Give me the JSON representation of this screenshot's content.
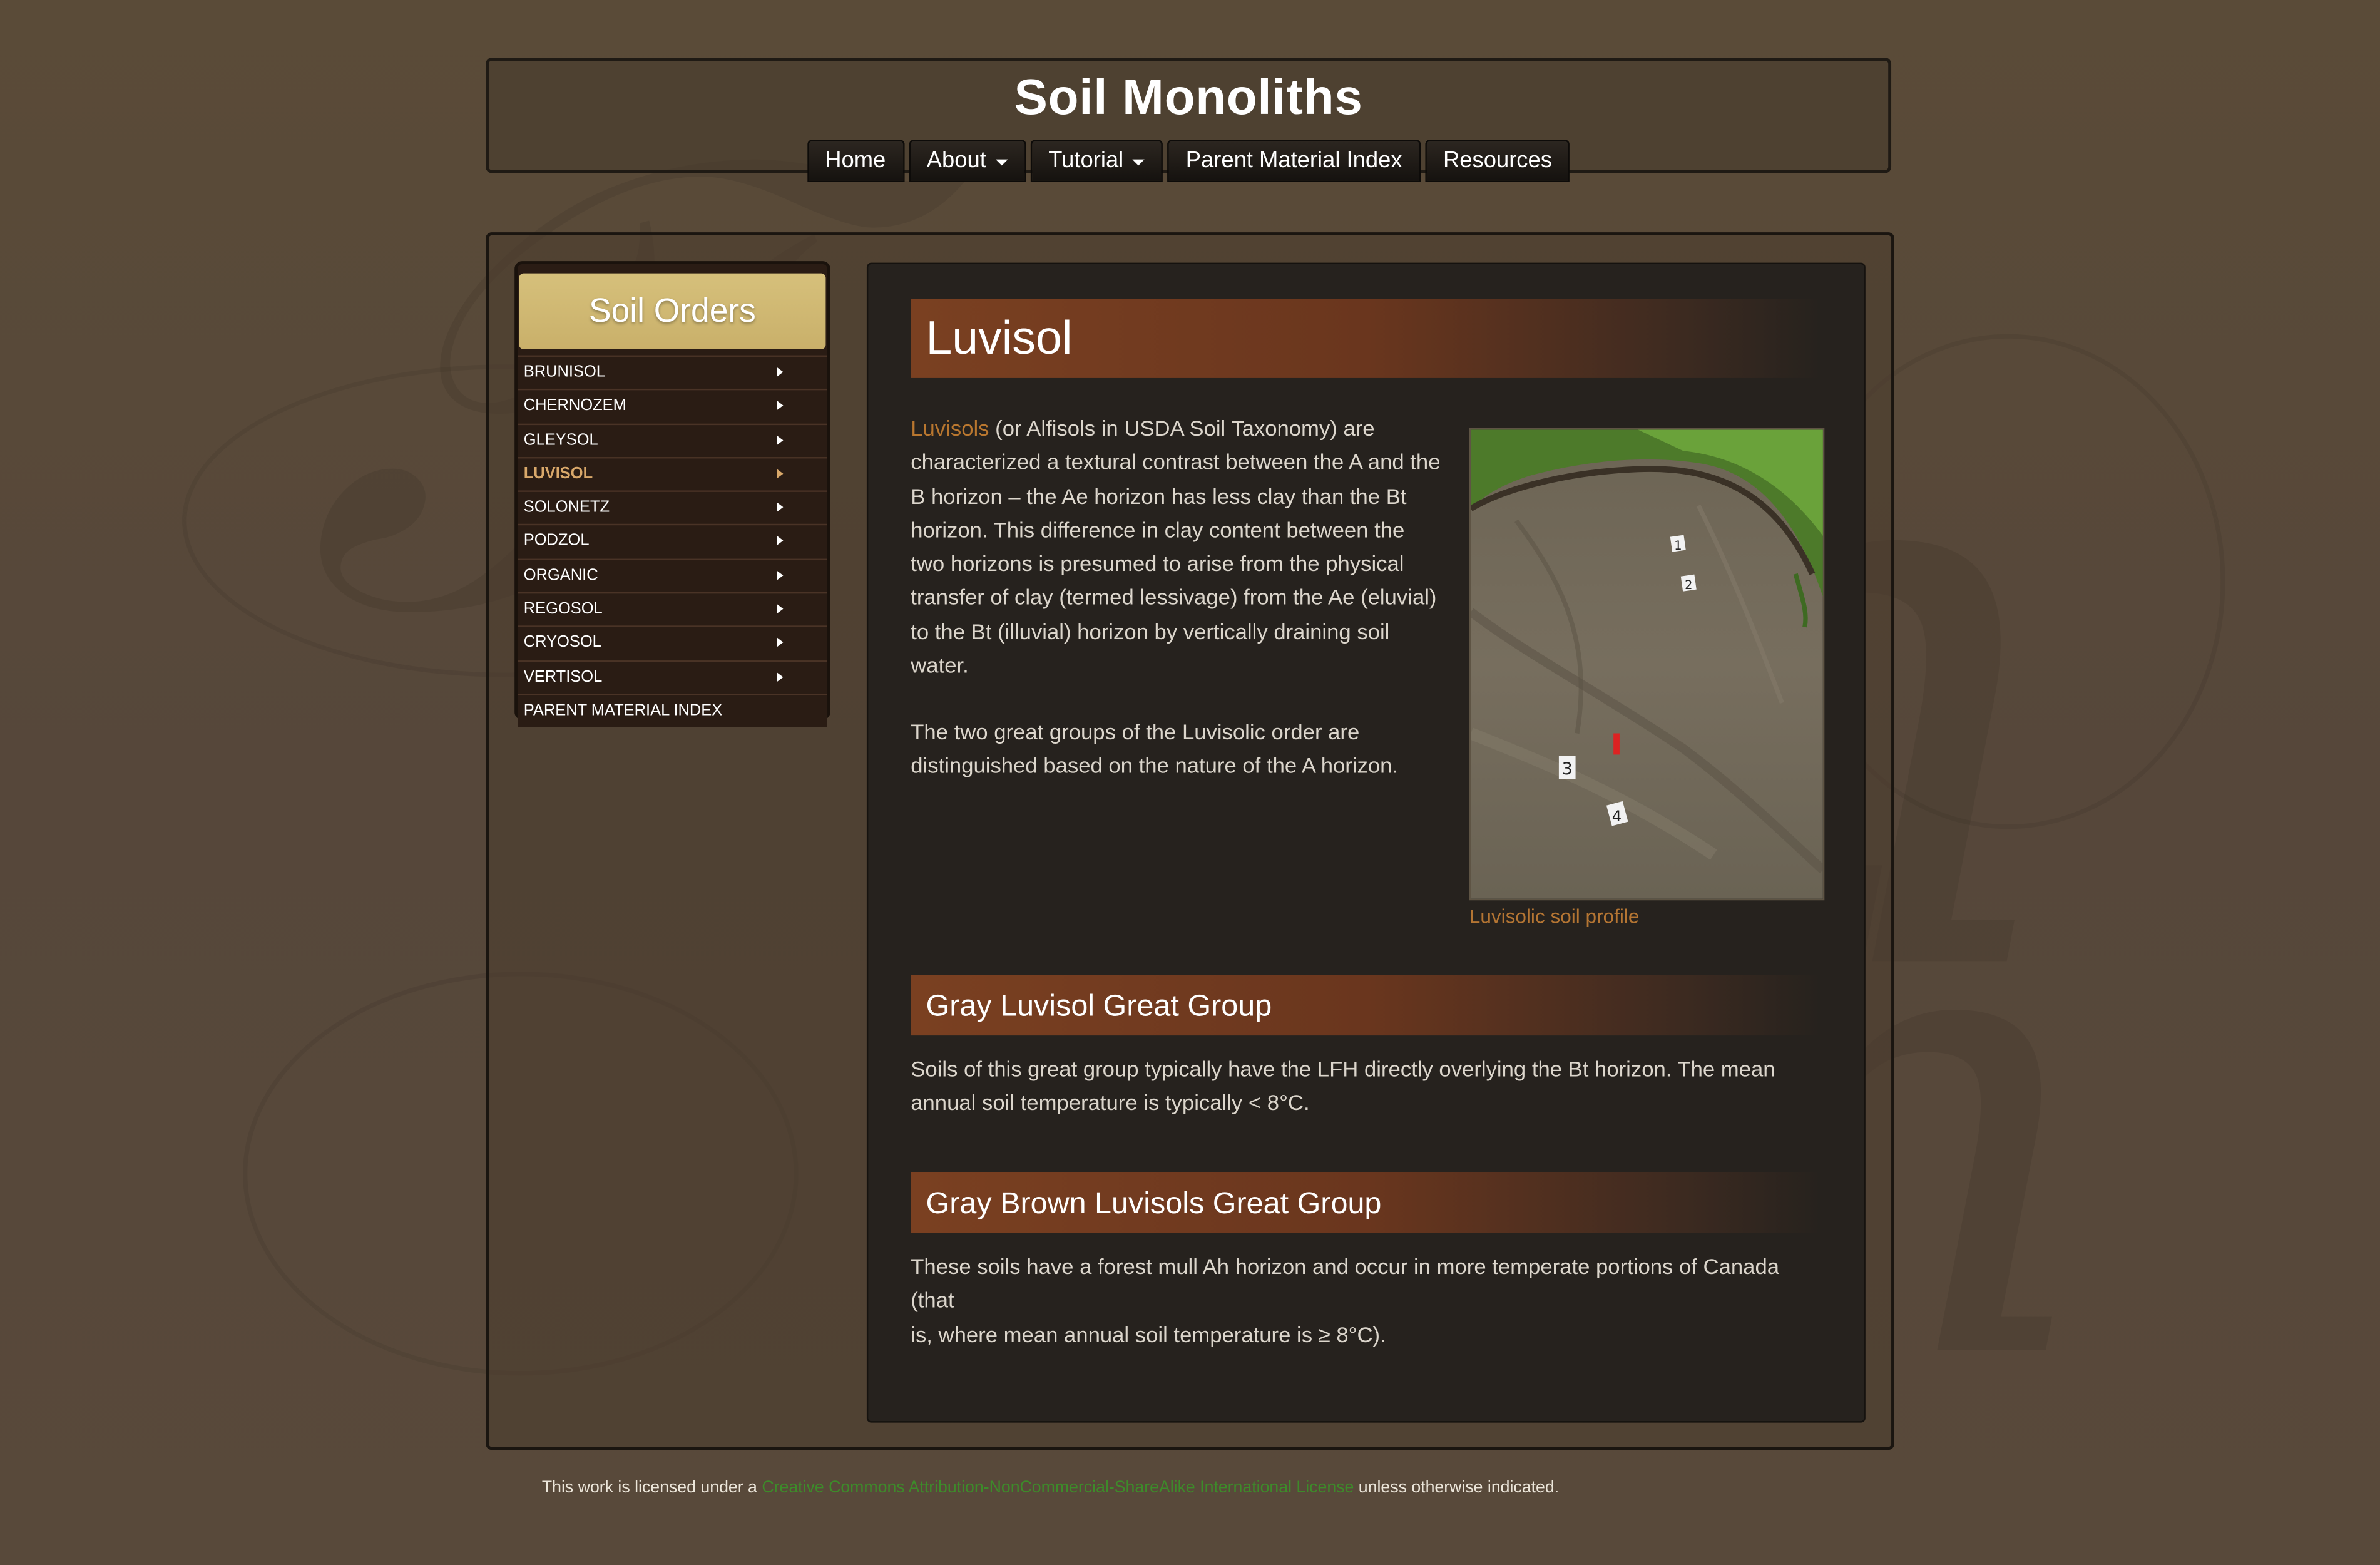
{
  "site": {
    "title": "Soil Monoliths"
  },
  "nav": [
    {
      "label": "Home"
    },
    {
      "label": "About"
    },
    {
      "label": "Tutorial"
    },
    {
      "label": "Parent Material Index"
    },
    {
      "label": "Resources"
    }
  ],
  "sidebar": {
    "title": "Soil Orders",
    "items": [
      {
        "label": "BRUNISOL"
      },
      {
        "label": "CHERNOZEM"
      },
      {
        "label": "GLEYSOL"
      },
      {
        "label": "LUVISOL"
      },
      {
        "label": "SOLONETZ"
      },
      {
        "label": "PODZOL"
      },
      {
        "label": "ORGANIC"
      },
      {
        "label": "REGOSOL"
      },
      {
        "label": "CRYOSOL"
      },
      {
        "label": "VERTISOL"
      },
      {
        "label": "PARENT MATERIAL INDEX"
      }
    ],
    "active_item": "LUVISOL"
  },
  "main": {
    "heading": "Luvisol",
    "intro_link": "Luvisols",
    "intro_line1_rest": " (or Alfisols in USDA Soil Taxonomy) are",
    "intro_lines": [
      "characterized a textural contrast between the A and the",
      "B horizon – the Ae horizon has less clay than the Bt",
      "horizon. This difference in clay content between the",
      "two horizons is presumed to arise from the physical",
      "transfer of clay (termed lessivage) from the Ae (eluvial)",
      "to the Bt (illuvial) horizon by vertically draining soil",
      "water."
    ],
    "second_para_lines": [
      "The two great groups of the Luvisolic order are",
      "distinguished based on the nature of the A horizon."
    ],
    "image_caption": "Luvisolic soil profile",
    "photo_markers": [
      "1",
      "2",
      "3",
      "4"
    ],
    "sections": [
      {
        "heading": "Gray Luvisol Great Group",
        "lines": [
          "Soils of this great group typically have the LFH directly overlying the Bt horizon. The mean",
          "annual soil temperature is typically < 8°C."
        ]
      },
      {
        "heading": "Gray Brown Luvisols Great Group",
        "lines": [
          "These soils have a forest mull Ah horizon and occur in more temperate portions of Canada (that",
          "is, where mean annual soil temperature is ≥ 8°C)."
        ]
      }
    ]
  },
  "footer": {
    "prefix": "This work is licensed under a ",
    "link": "Creative Commons Attribution-NonCommercial-ShareAlike International License",
    "suffix": " unless otherwise indicated."
  },
  "colors": {
    "page_bg": "#574936",
    "content_bg": "#26221e",
    "banner_start": "#7a4021",
    "sidebar_title_bg": "#d6c07b",
    "link": "#b9772f",
    "active_nav": "#d9a86a",
    "footer_link": "#3d8b2a"
  },
  "icons": [
    "caret-down-icon",
    "chevron-right-icon"
  ]
}
